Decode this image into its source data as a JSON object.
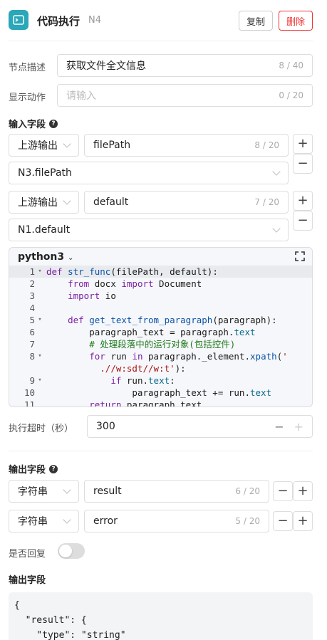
{
  "header": {
    "title": "代码执行",
    "node_id": "N4",
    "copy_label": "复制",
    "delete_label": "删除",
    "icon": "terminal-icon"
  },
  "node_desc": {
    "label": "节点描述",
    "value": "获取文件全文信息",
    "count": "8 / 40"
  },
  "display_action": {
    "label": "显示动作",
    "placeholder": "请输入",
    "count": "0 / 20"
  },
  "input_section": {
    "title": "输入字段",
    "fields": [
      {
        "source": "上游输出",
        "name": "filePath",
        "count": "8 / 20",
        "ref": "N3.filePath"
      },
      {
        "source": "上游输出",
        "name": "default",
        "count": "7 / 20",
        "ref": "N1.default"
      }
    ]
  },
  "code": {
    "language": "python3",
    "lines": [
      {
        "n": "1",
        "fold": true
      },
      {
        "n": "2"
      },
      {
        "n": "3"
      },
      {
        "n": "4"
      },
      {
        "n": "5",
        "fold": true
      },
      {
        "n": "6"
      },
      {
        "n": "7"
      },
      {
        "n": "8",
        "fold": true
      },
      {
        "n": ""
      },
      {
        "n": "9",
        "fold": true
      },
      {
        "n": "10"
      },
      {
        "n": "11"
      }
    ]
  },
  "timeout": {
    "label": "执行超时（秒）",
    "value": "300"
  },
  "output_section": {
    "title": "输出字段",
    "fields": [
      {
        "type": "字符串",
        "name": "result",
        "count": "6 / 20"
      },
      {
        "type": "字符串",
        "name": "error",
        "count": "5 / 20"
      }
    ]
  },
  "reply": {
    "label": "是否回复",
    "enabled": false
  },
  "output_preview": {
    "title": "输出字段",
    "lines": [
      "{",
      "  \"result\": {",
      "    \"type\": \"string\""
    ]
  }
}
